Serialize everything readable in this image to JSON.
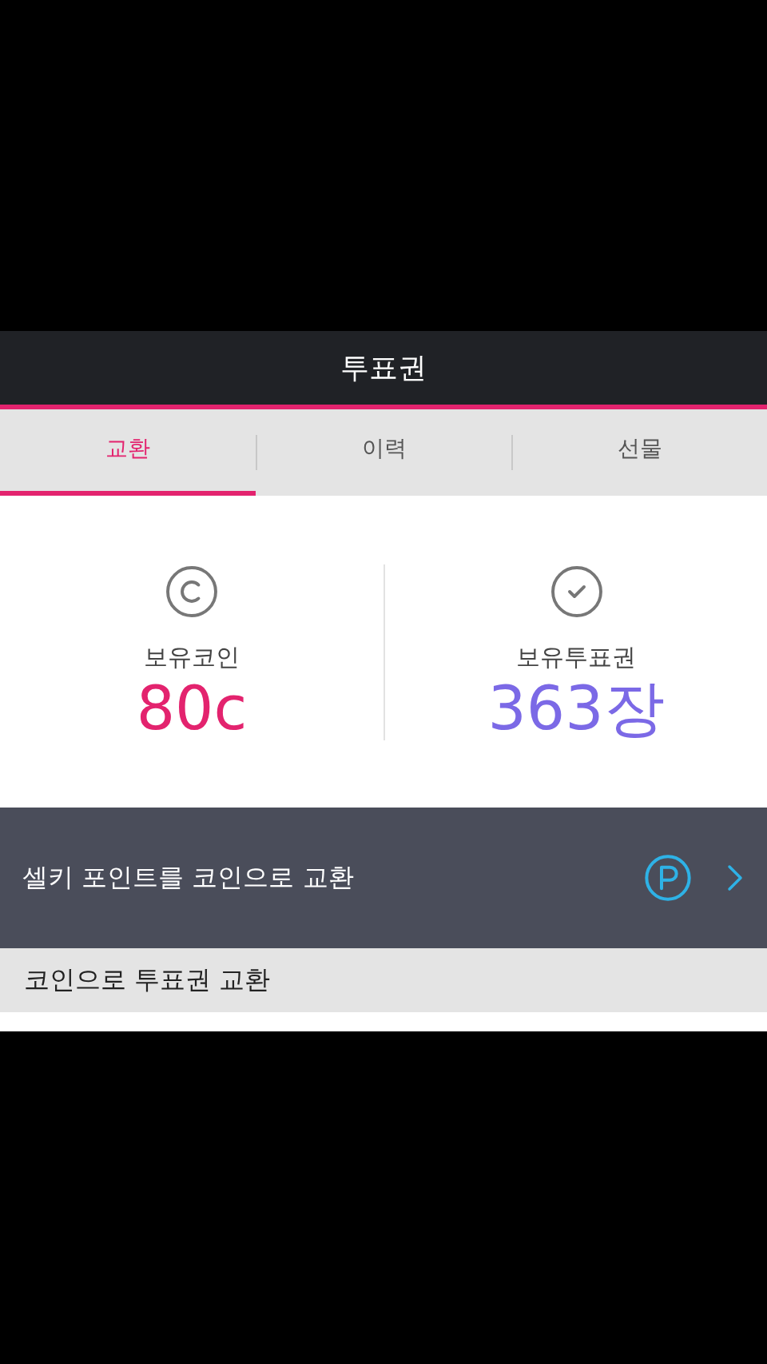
{
  "header": {
    "title": "투표권"
  },
  "tabs": [
    {
      "label": "교환",
      "selected": true
    },
    {
      "label": "이력",
      "selected": false
    },
    {
      "label": "선물",
      "selected": false
    }
  ],
  "stats": [
    {
      "kind": "coin",
      "label": "보유코인",
      "value": "80c",
      "color": "#e3236e"
    },
    {
      "kind": "ticket",
      "label": "보유투표권",
      "value": "363장",
      "color": "#7b69e6"
    }
  ],
  "banner": {
    "text": "셀키 포인트를 코인으로 교환"
  },
  "section": {
    "title": "코인으로 투표권 교환"
  }
}
